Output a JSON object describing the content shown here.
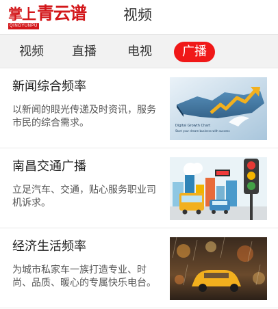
{
  "header": {
    "logo_small": "掌上",
    "logo_big": "青云谱",
    "logo_sub": "QINGYUNPU",
    "title": "视频"
  },
  "tabs": [
    {
      "label": "视频",
      "active": false
    },
    {
      "label": "直播",
      "active": false
    },
    {
      "label": "电视",
      "active": false
    },
    {
      "label": "广播",
      "active": true
    }
  ],
  "items": [
    {
      "title": "新闻综合频率",
      "description": "以新闻的眼光传递及时资讯，服务市民的综合需求。",
      "thumb_icon": "business-map-arrow-thumbnail",
      "thumb_text_1": "Digital Growth Chart",
      "thumb_text_2": "Start your dream business with success"
    },
    {
      "title": "南昌交通广播",
      "description": "立足汽车、交通，贴心服务职业司机诉求。",
      "thumb_icon": "traffic-light-city-thumbnail"
    },
    {
      "title": "经济生活频率",
      "description": "为城市私家车一族打造专业、时尚、品质、暖心的专属快乐电台。",
      "thumb_icon": "rainy-street-taxi-thumbnail"
    }
  ],
  "colors": {
    "accent": "#f01818",
    "logo_red": "#d3171a",
    "tab_bar_bg": "#f2f2f2"
  }
}
